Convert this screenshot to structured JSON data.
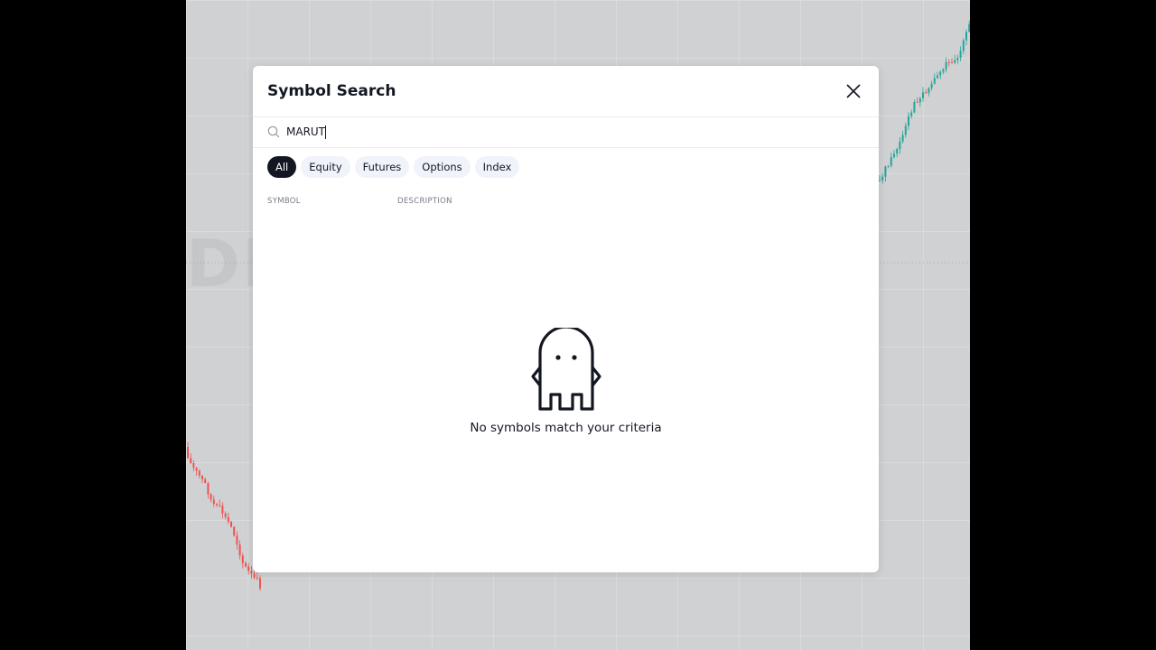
{
  "dialog": {
    "title": "Symbol Search",
    "close_icon": "close-icon"
  },
  "search": {
    "value": "MARUT",
    "placeholder": "",
    "icon": "search-icon"
  },
  "filters": [
    {
      "label": "All",
      "active": true
    },
    {
      "label": "Equity",
      "active": false
    },
    {
      "label": "Futures",
      "active": false
    },
    {
      "label": "Options",
      "active": false
    },
    {
      "label": "Index",
      "active": false
    }
  ],
  "columns": {
    "symbol": "SYMBOL",
    "description": "DESCRIPTION"
  },
  "empty_state": {
    "icon": "ghost-icon",
    "message": "No symbols match your criteria"
  },
  "colors": {
    "accent_dark": "#131722",
    "candle_up": "#26a69a",
    "candle_down": "#ef5350",
    "overlay": "#cfd1d3"
  }
}
